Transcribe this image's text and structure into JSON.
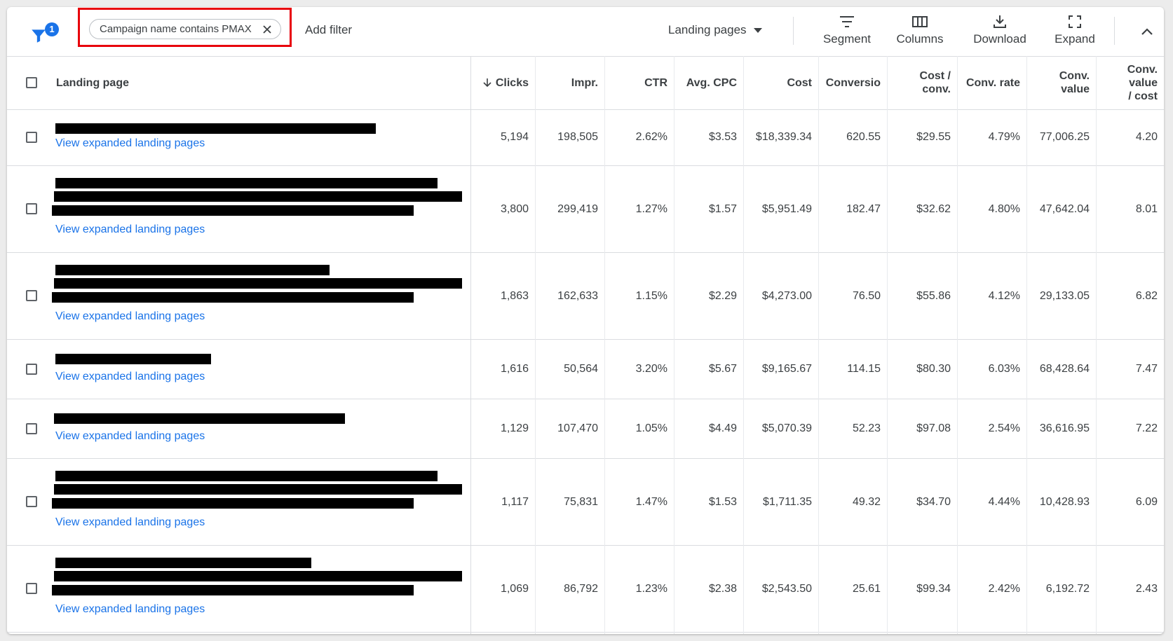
{
  "toolbar": {
    "filter_count": "1",
    "chip_label": "Campaign name contains PMAX",
    "add_filter": "Add filter",
    "view_select": "Landing pages",
    "segment": "Segment",
    "columns": "Columns",
    "download": "Download",
    "expand": "Expand"
  },
  "table": {
    "headers": {
      "landing_page": "Landing page",
      "clicks": "Clicks",
      "impr": "Impr.",
      "ctr": "CTR",
      "avg_cpc": "Avg. CPC",
      "cost": "Cost",
      "conversions": "Conversio",
      "cost_per_conv": "Cost / conv.",
      "conv_rate": "Conv. rate",
      "conv_value": "Conv. value",
      "conv_value_cost": "Conv. value / cost"
    },
    "link_label": "View expanded landing pages",
    "rows": [
      {
        "clicks": "5,194",
        "impr": "198,505",
        "ctr": "2.62%",
        "avg_cpc": "$3.53",
        "cost": "$18,339.34",
        "conversions": "620.55",
        "cost_per_conv": "$29.55",
        "conv_rate": "4.79%",
        "conv_value": "77,006.25",
        "conv_value_cost": "4.20"
      },
      {
        "clicks": "3,800",
        "impr": "299,419",
        "ctr": "1.27%",
        "avg_cpc": "$1.57",
        "cost": "$5,951.49",
        "conversions": "182.47",
        "cost_per_conv": "$32.62",
        "conv_rate": "4.80%",
        "conv_value": "47,642.04",
        "conv_value_cost": "8.01"
      },
      {
        "clicks": "1,863",
        "impr": "162,633",
        "ctr": "1.15%",
        "avg_cpc": "$2.29",
        "cost": "$4,273.00",
        "conversions": "76.50",
        "cost_per_conv": "$55.86",
        "conv_rate": "4.12%",
        "conv_value": "29,133.05",
        "conv_value_cost": "6.82"
      },
      {
        "clicks": "1,616",
        "impr": "50,564",
        "ctr": "3.20%",
        "avg_cpc": "$5.67",
        "cost": "$9,165.67",
        "conversions": "114.15",
        "cost_per_conv": "$80.30",
        "conv_rate": "6.03%",
        "conv_value": "68,428.64",
        "conv_value_cost": "7.47"
      },
      {
        "clicks": "1,129",
        "impr": "107,470",
        "ctr": "1.05%",
        "avg_cpc": "$4.49",
        "cost": "$5,070.39",
        "conversions": "52.23",
        "cost_per_conv": "$97.08",
        "conv_rate": "2.54%",
        "conv_value": "36,616.95",
        "conv_value_cost": "7.22"
      },
      {
        "clicks": "1,117",
        "impr": "75,831",
        "ctr": "1.47%",
        "avg_cpc": "$1.53",
        "cost": "$1,711.35",
        "conversions": "49.32",
        "cost_per_conv": "$34.70",
        "conv_rate": "4.44%",
        "conv_value": "10,428.93",
        "conv_value_cost": "6.09"
      },
      {
        "clicks": "1,069",
        "impr": "86,792",
        "ctr": "1.23%",
        "avg_cpc": "$2.38",
        "cost": "$2,543.50",
        "conversions": "25.61",
        "cost_per_conv": "$99.34",
        "conv_rate": "2.42%",
        "conv_value": "6,192.72",
        "conv_value_cost": "2.43"
      }
    ]
  },
  "colors": {
    "accent": "#1a73e8",
    "highlight_border": "#e8000b"
  }
}
